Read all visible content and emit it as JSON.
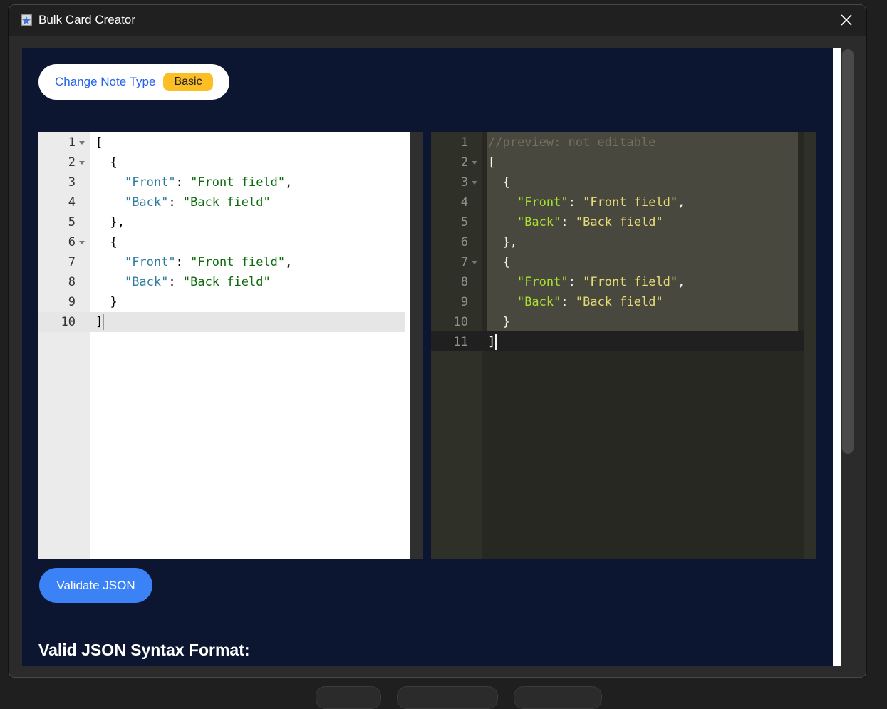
{
  "window": {
    "title": "Bulk Card Creator"
  },
  "note_type": {
    "label": "Change Note Type",
    "value": "Basic"
  },
  "input_editor": {
    "lines": [
      {
        "n": "1",
        "fold": true,
        "tokens": [
          {
            "t": "["
          }
        ]
      },
      {
        "n": "2",
        "fold": true,
        "tokens": [
          {
            "t": "  {"
          }
        ]
      },
      {
        "n": "3",
        "fold": false,
        "tokens": [
          {
            "t": "    "
          },
          {
            "t": "\"Front\"",
            "c": "k"
          },
          {
            "t": ": "
          },
          {
            "t": "\"Front field\"",
            "c": "s"
          },
          {
            "t": ","
          }
        ]
      },
      {
        "n": "4",
        "fold": false,
        "tokens": [
          {
            "t": "    "
          },
          {
            "t": "\"Back\"",
            "c": "k"
          },
          {
            "t": ": "
          },
          {
            "t": "\"Back field\"",
            "c": "s"
          }
        ]
      },
      {
        "n": "5",
        "fold": false,
        "tokens": [
          {
            "t": "  },"
          }
        ]
      },
      {
        "n": "6",
        "fold": true,
        "tokens": [
          {
            "t": "  {"
          }
        ]
      },
      {
        "n": "7",
        "fold": false,
        "tokens": [
          {
            "t": "    "
          },
          {
            "t": "\"Front\"",
            "c": "k"
          },
          {
            "t": ": "
          },
          {
            "t": "\"Front field\"",
            "c": "s"
          },
          {
            "t": ","
          }
        ]
      },
      {
        "n": "8",
        "fold": false,
        "tokens": [
          {
            "t": "    "
          },
          {
            "t": "\"Back\"",
            "c": "k"
          },
          {
            "t": ": "
          },
          {
            "t": "\"Back field\"",
            "c": "s"
          }
        ]
      },
      {
        "n": "9",
        "fold": false,
        "tokens": [
          {
            "t": "  }"
          }
        ]
      },
      {
        "n": "10",
        "fold": false,
        "tokens": [
          {
            "t": "]"
          }
        ]
      }
    ]
  },
  "preview_editor": {
    "lines": [
      {
        "n": "1",
        "fold": false,
        "tokens": [
          {
            "t": "//preview: not editable",
            "c": "c"
          }
        ]
      },
      {
        "n": "2",
        "fold": true,
        "tokens": [
          {
            "t": "["
          }
        ]
      },
      {
        "n": "3",
        "fold": true,
        "tokens": [
          {
            "t": "  {"
          }
        ]
      },
      {
        "n": "4",
        "fold": false,
        "tokens": [
          {
            "t": "    "
          },
          {
            "t": "\"Front\"",
            "c": "k"
          },
          {
            "t": ": "
          },
          {
            "t": "\"Front field\"",
            "c": "s"
          },
          {
            "t": ","
          }
        ]
      },
      {
        "n": "5",
        "fold": false,
        "tokens": [
          {
            "t": "    "
          },
          {
            "t": "\"Back\"",
            "c": "k"
          },
          {
            "t": ": "
          },
          {
            "t": "\"Back field\"",
            "c": "s"
          }
        ]
      },
      {
        "n": "6",
        "fold": false,
        "tokens": [
          {
            "t": "  },"
          }
        ]
      },
      {
        "n": "7",
        "fold": true,
        "tokens": [
          {
            "t": "  {"
          }
        ]
      },
      {
        "n": "8",
        "fold": false,
        "tokens": [
          {
            "t": "    "
          },
          {
            "t": "\"Front\"",
            "c": "k"
          },
          {
            "t": ": "
          },
          {
            "t": "\"Front field\"",
            "c": "s"
          },
          {
            "t": ","
          }
        ]
      },
      {
        "n": "9",
        "fold": false,
        "tokens": [
          {
            "t": "    "
          },
          {
            "t": "\"Back\"",
            "c": "k"
          },
          {
            "t": ": "
          },
          {
            "t": "\"Back field\"",
            "c": "s"
          }
        ]
      },
      {
        "n": "10",
        "fold": false,
        "tokens": [
          {
            "t": "  }"
          }
        ]
      },
      {
        "n": "11",
        "fold": false,
        "tokens": [
          {
            "t": "]"
          }
        ]
      }
    ]
  },
  "actions": {
    "validate_label": "Validate JSON"
  },
  "section": {
    "heading": "Valid JSON Syntax Format:"
  }
}
